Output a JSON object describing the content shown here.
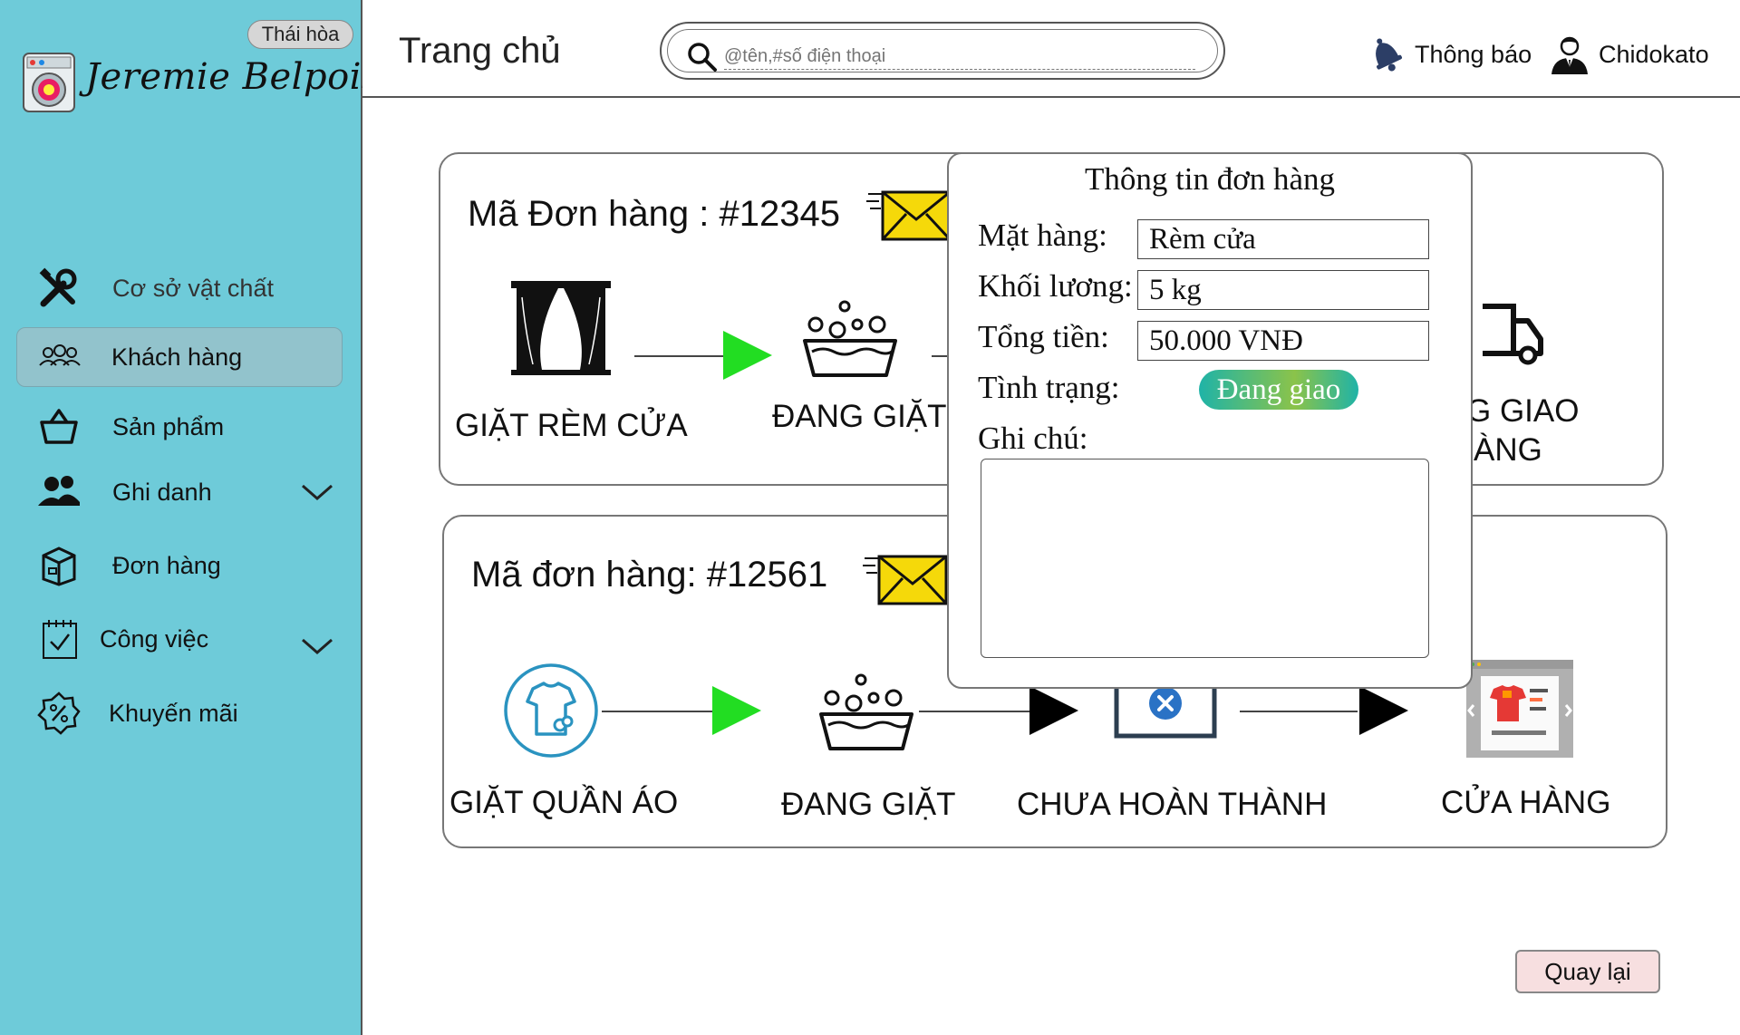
{
  "sidebar": {
    "branch_badge": "Thái hòa",
    "brand_name": "Jeremie Belpois",
    "items": [
      {
        "label": "Cơ sở vật chất",
        "icon": "tools-icon"
      },
      {
        "label": "Khách hàng",
        "icon": "customers-icon",
        "active": true
      },
      {
        "label": "Sản phẩm",
        "icon": "basket-icon"
      },
      {
        "label": "Ghi danh",
        "icon": "users-icon",
        "has_submenu": true
      },
      {
        "label": "Đơn hàng",
        "icon": "package-icon"
      },
      {
        "label": "Công việc",
        "icon": "calendar-check-icon",
        "has_submenu": true
      },
      {
        "label": "Khuyến mãi",
        "icon": "discount-icon"
      }
    ]
  },
  "header": {
    "title": "Trang chủ",
    "search_placeholder": "@tên,#số điện thoại",
    "notifications_label": "Thông báo",
    "user_name": "Chidokato"
  },
  "orders": [
    {
      "title": "Mã Đơn hàng : #12345",
      "steps": [
        {
          "label": "GIẶT RÈM CỬA",
          "icon": "curtain-icon"
        },
        {
          "label": "ĐANG GIẶT",
          "icon": "washing-basin-icon"
        },
        {
          "label_line1": "G GIAO",
          "label_line2": "ÀNG",
          "icon": "delivery-truck-icon"
        }
      ],
      "arrow_colors": [
        "#22dd22"
      ]
    },
    {
      "title": "Mã đơn hàng: #12561",
      "steps": [
        {
          "label": "GIẶT QUẦN ÁO",
          "icon": "laundry-shirt-icon"
        },
        {
          "label": "ĐANG GIẶT",
          "icon": "washing-basin-icon"
        },
        {
          "label": "CHƯA HOÀN THÀNH",
          "icon": "incomplete-icon"
        },
        {
          "label": "CỬA HÀNG",
          "icon": "store-icon"
        }
      ],
      "arrow_colors": [
        "#22dd22",
        "#000000",
        "#000000"
      ]
    }
  ],
  "popup": {
    "title": "Thông tin đơn hàng",
    "item_label": "Mặt hàng:",
    "item_value": "Rèm cửa",
    "weight_label": "Khối lương:",
    "weight_value": "5 kg",
    "total_label": "Tổng tiền:",
    "total_value": "50.000 VNĐ",
    "status_label": "Tình trạng:",
    "status_value": "Đang giao",
    "note_label": "Ghi chú:",
    "note_value": ""
  },
  "back_button": "Quay lại",
  "colors": {
    "sidebar_bg": "#6ecbd9",
    "active_item_bg": "#92c3cc",
    "progress_arrow": "#22dd22",
    "status_badge": "#1fb3a7",
    "mail_yellow": "#f5d90a",
    "back_button_bg": "#f7dfe0"
  }
}
